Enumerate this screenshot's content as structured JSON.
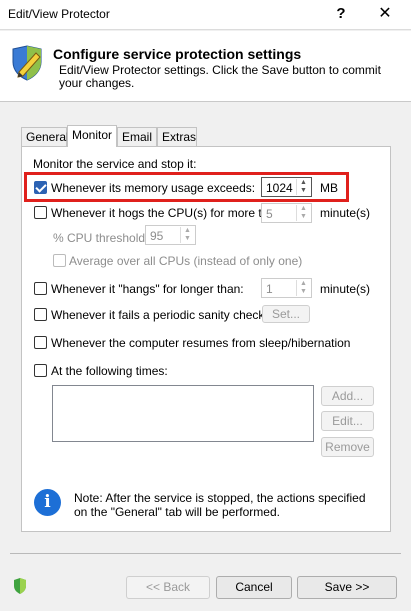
{
  "window": {
    "title": "Edit/View Protector",
    "help_label": "?",
    "close_label": "✕"
  },
  "header": {
    "title": "Configure service protection settings",
    "description": "Edit/View Protector settings. Click the Save button to commit your changes."
  },
  "tabs": [
    {
      "label": "General",
      "active": false
    },
    {
      "label": "Monitor",
      "active": true
    },
    {
      "label": "Email",
      "active": false
    },
    {
      "label": "Extras",
      "active": false
    }
  ],
  "monitor": {
    "section_label": "Monitor the service and stop it:",
    "memory": {
      "label": "Whenever its memory usage exceeds:",
      "checked": true,
      "value": "1024",
      "unit": "MB"
    },
    "cpu": {
      "label": "Whenever it hogs the CPU(s) for more than:",
      "checked": false,
      "value": "5",
      "unit": "minute(s)"
    },
    "cpu_threshold": {
      "label": "% CPU threshold:",
      "value": "95"
    },
    "average_cpus": {
      "label": "Average over all CPUs (instead of only one)",
      "checked": false
    },
    "hangs": {
      "label": "Whenever it \"hangs\" for longer than:",
      "checked": false,
      "value": "1",
      "unit": "minute(s)"
    },
    "sanity": {
      "label": "Whenever it fails a periodic sanity check",
      "checked": false,
      "button": "Set..."
    },
    "resume": {
      "label": "Whenever the computer resumes from sleep/hibernation",
      "checked": false
    },
    "times": {
      "label": "At the following times:",
      "checked": false,
      "add": "Add...",
      "edit": "Edit...",
      "remove": "Remove"
    },
    "note": "Note: After the service is stopped, the actions specified on the \"General\" tab will be performed."
  },
  "footer": {
    "back": "<< Back",
    "cancel": "Cancel",
    "save": "Save >>"
  },
  "colors": {
    "accent": "#2c62b3",
    "highlight": "#e0201c",
    "info": "#1d6fd6"
  }
}
